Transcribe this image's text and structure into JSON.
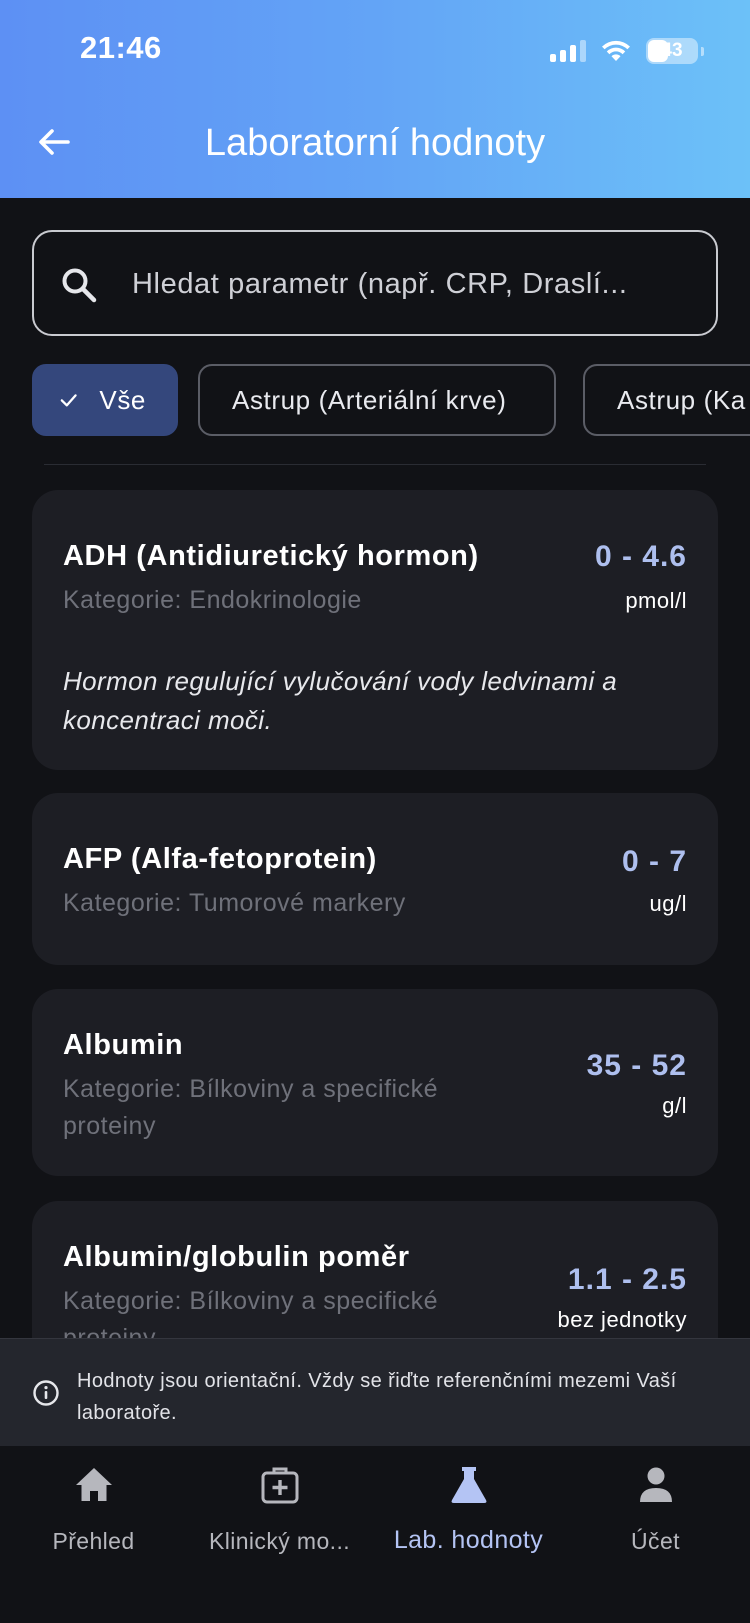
{
  "status_bar": {
    "time": "21:46",
    "battery": "43"
  },
  "header": {
    "title": "Laboratorní hodnoty"
  },
  "search": {
    "placeholder": "Hledat parametr (např. CRP, Draslí..."
  },
  "filters": [
    {
      "label": "Vše",
      "active": true
    },
    {
      "label": "Astrup (Arteriální krve)",
      "active": false
    },
    {
      "label": "Astrup (Ka",
      "active": false
    }
  ],
  "cards": [
    {
      "name": "ADH (Antidiuretický hormon)",
      "category": "Kategorie: Endokrinologie",
      "range": "0 - 4.6",
      "unit": "pmol/l",
      "description": "Hormon regulující vylučování vody ledvinami a koncentraci moči."
    },
    {
      "name": "AFP (Alfa-fetoprotein)",
      "category": "Kategorie: Tumorové markery",
      "range": "0 - 7",
      "unit": "ug/l"
    },
    {
      "name": "Albumin",
      "category": "Kategorie: Bílkoviny a specifické proteiny",
      "range": "35 - 52",
      "unit": "g/l"
    },
    {
      "name": "Albumin/globulin poměr",
      "category": "Kategorie: Bílkoviny a specifické proteiny",
      "range": "1.1 - 2.5",
      "unit": "bez jednotky"
    }
  ],
  "disclaimer": {
    "text": "Hodnoty jsou orientační. Vždy se řiďte referenčními mezemi Vaší laboratoře."
  },
  "nav": [
    {
      "label": "Přehled",
      "icon": "home-icon",
      "active": false
    },
    {
      "label": "Klinický mo...",
      "icon": "medical-kit-icon",
      "active": false
    },
    {
      "label": "Lab. hodnoty",
      "icon": "flask-icon",
      "active": true
    },
    {
      "label": "Účet",
      "icon": "person-icon",
      "active": false
    }
  ],
  "colors": {
    "header_gradient_start": "#5d90f4",
    "header_gradient_end": "#6cc1f8",
    "background": "#111216",
    "card": "#1d1e24",
    "accent": "#aebfee",
    "chip_active": "#34477c"
  }
}
